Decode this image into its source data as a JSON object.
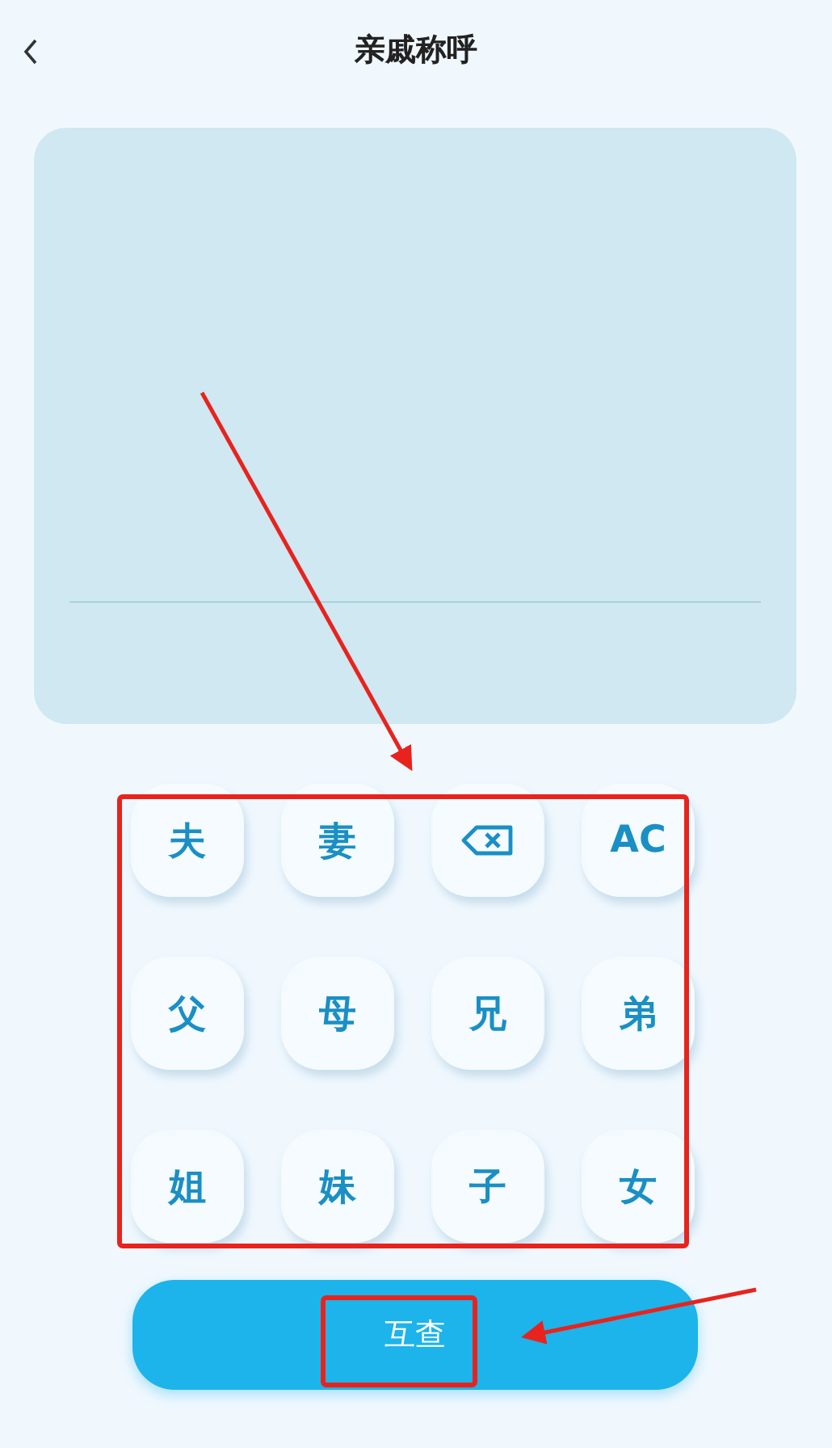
{
  "header": {
    "title": "亲戚称呼"
  },
  "keypad": [
    {
      "kind": "key",
      "label": "夫"
    },
    {
      "kind": "key",
      "label": "妻"
    },
    {
      "kind": "backspace"
    },
    {
      "kind": "key",
      "label": "AC"
    },
    {
      "kind": "key",
      "label": "父"
    },
    {
      "kind": "key",
      "label": "母"
    },
    {
      "kind": "key",
      "label": "兄"
    },
    {
      "kind": "key",
      "label": "弟"
    },
    {
      "kind": "key",
      "label": "姐"
    },
    {
      "kind": "key",
      "label": "妹"
    },
    {
      "kind": "key",
      "label": "子"
    },
    {
      "kind": "key",
      "label": "女"
    }
  ],
  "action_button": {
    "label": "互查"
  }
}
